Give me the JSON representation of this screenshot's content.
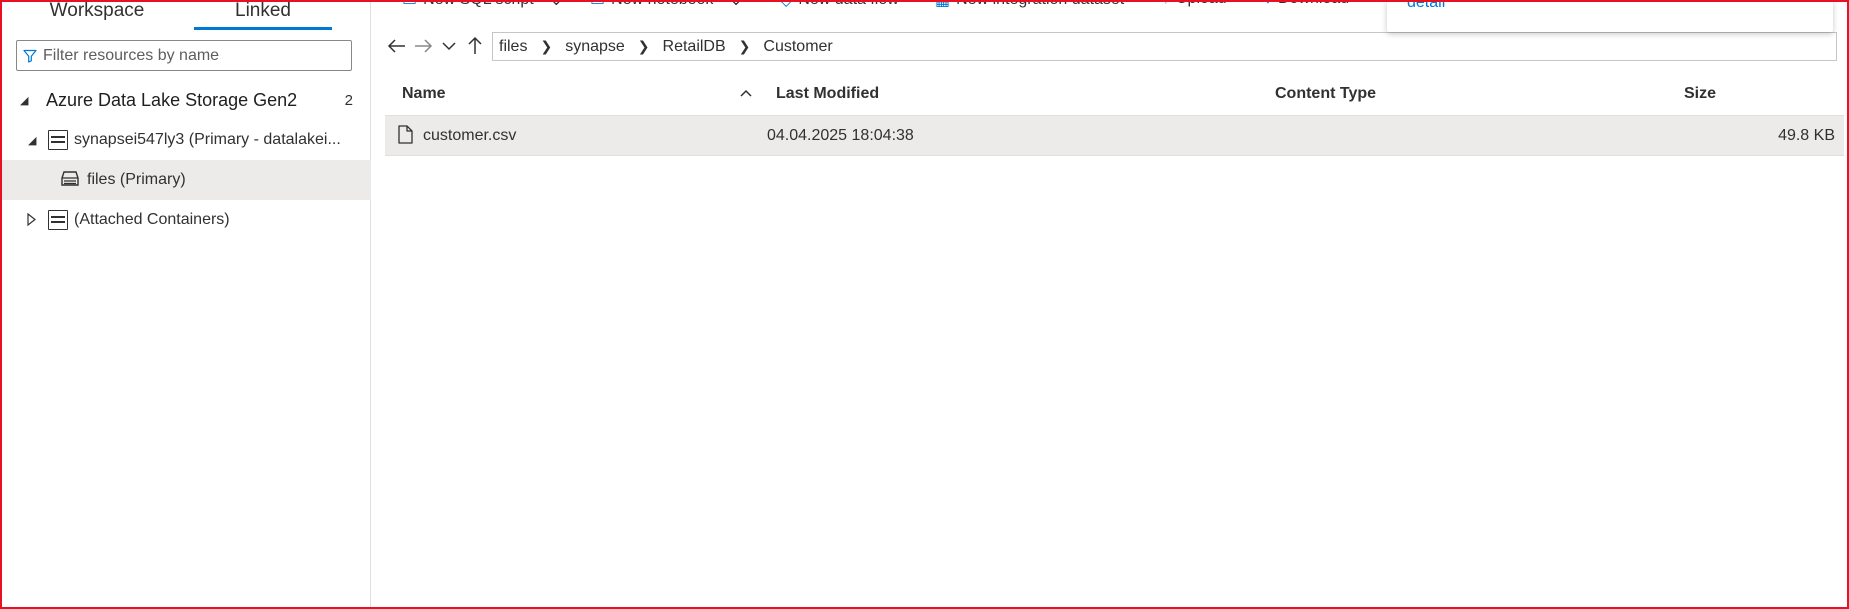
{
  "tabs": {
    "workspace": "Workspace",
    "linked": "Linked"
  },
  "filter": {
    "placeholder": "Filter resources by name"
  },
  "tree": {
    "section_label": "Azure Data Lake Storage Gen2",
    "section_count": "2",
    "account_label": "synapsei547ly3 (Primary - datalakei...",
    "container_label": "files (Primary)",
    "attached_label": "(Attached Containers)"
  },
  "toolbar": {
    "new_sql_script": "New SQL script",
    "new_notebook": "New notebook",
    "new_data_flow": "New data flow",
    "new_integration_dataset": "New integration dataset",
    "upload": "Upload",
    "download": "Download"
  },
  "popup": {
    "link": "detail"
  },
  "breadcrumb": [
    "files",
    "synapse",
    "RetailDB",
    "Customer"
  ],
  "table": {
    "columns": {
      "name": "Name",
      "last_modified": "Last Modified",
      "content_type": "Content Type",
      "size": "Size"
    },
    "rows": [
      {
        "name": "customer.csv",
        "last_modified": "04.04.2025 18:04:38",
        "content_type": "",
        "size": "49.8 KB"
      }
    ]
  },
  "colors": {
    "accent": "#0078d4",
    "selected_row": "#edebe9",
    "border_frame": "#e81123"
  },
  "icons": [
    "filter-icon",
    "storage-account-icon",
    "container-icon",
    "back-arrow-icon",
    "forward-arrow-icon",
    "chevron-down-icon",
    "up-arrow-icon",
    "file-icon",
    "sort-caret-icon"
  ]
}
